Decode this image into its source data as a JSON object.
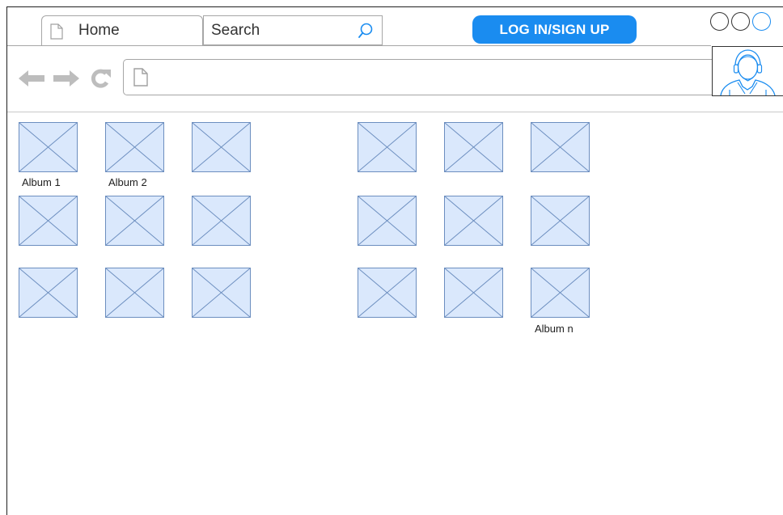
{
  "browser": {
    "tab_label": "Home",
    "search_placeholder": "Search",
    "login_button_label": "LOG IN/SIGN UP",
    "window_controls": [
      "minimize",
      "maximize",
      "close"
    ],
    "accent_color": "#1a8cf0"
  },
  "navigation": {
    "icons": [
      "back-arrow-icon",
      "forward-arrow-icon",
      "reload-icon",
      "page-icon"
    ]
  },
  "user": {
    "avatar_icon": "user-avatar-icon"
  },
  "albums": {
    "placeholder_fill": "#dae8fc",
    "placeholder_stroke": "#6c8ebf",
    "labels": {
      "first": "Album 1",
      "second": "Album 2",
      "last": "Album n"
    },
    "rows": 3,
    "columns": 6
  }
}
